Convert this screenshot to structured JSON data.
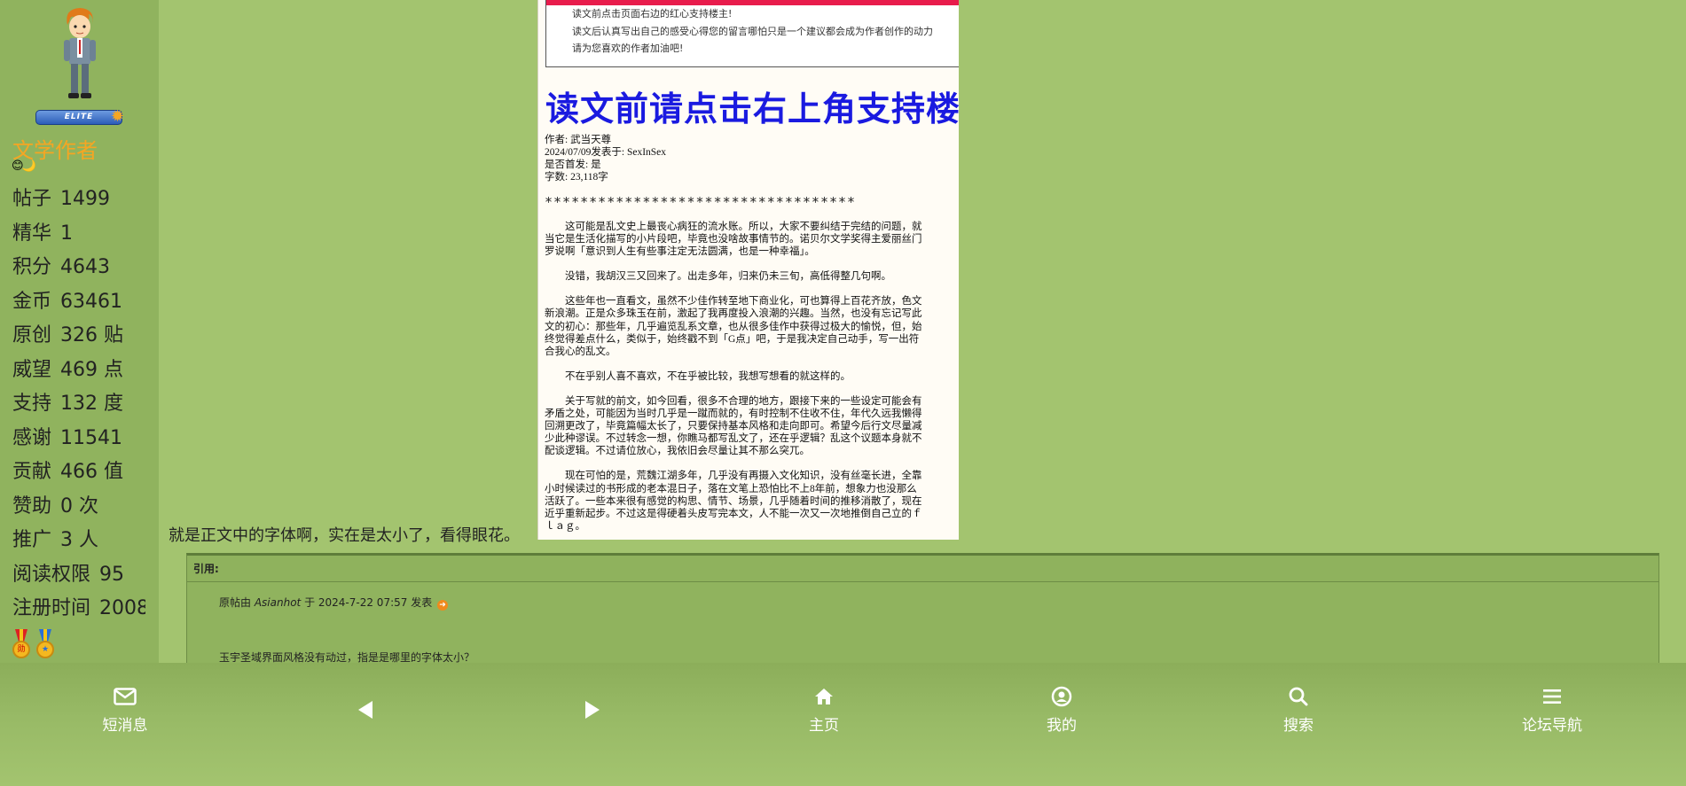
{
  "sidebar": {
    "rank_badge": "ELITE",
    "author_group": "文学作者",
    "emojis": "😊🌙",
    "stats": [
      {
        "label": "帖子",
        "value": "1499"
      },
      {
        "label": "精华",
        "value": "1"
      },
      {
        "label": "积分",
        "value": "4643"
      },
      {
        "label": "金币",
        "value": "63461"
      },
      {
        "label": "原创",
        "value": "326 贴"
      },
      {
        "label": "威望",
        "value": "469 点"
      },
      {
        "label": "支持",
        "value": "132 度"
      },
      {
        "label": "感谢",
        "value": "11541"
      },
      {
        "label": "贡献",
        "value": "466 值"
      },
      {
        "label": "赞助",
        "value": "0 次"
      },
      {
        "label": "推广",
        "value": "3 人"
      },
      {
        "label": "阅读权限",
        "value": "95"
      },
      {
        "label": "注册时间",
        "value": "2008"
      }
    ]
  },
  "screenshot": {
    "notice_lines": [
      "读文前点击页面右边的红心支持楼主!",
      "读文后认真写出自己的感受心得您的留言哪怕只是一个建议都会成为作者创作的动力",
      "请为您喜欢的作者加油吧!"
    ],
    "title": "读文前请点击右上角支持楼主",
    "meta_lines": [
      "作者: 武当天尊",
      "2024/07/09发表于: SexInSex",
      "是否首发: 是",
      "字数: 23,118字"
    ],
    "stars": "***********************************",
    "paragraphs": [
      "这可能是乱文史上最丧心病狂的流水账。所以，大家不要纠结于完结的问题，就当它是生活化描写的小片段吧，毕竟也没啥故事情节的。诺贝尔文学奖得主爱丽丝门罗说啊「意识到人生有些事注定无法圆满，也是一种幸福」。",
      "没错，我胡汉三又回来了。出走多年，归来仍未三旬，高低得整几句啊。",
      "这些年也一直看文，虽然不少佳作转至地下商业化，可也算得上百花齐放，色文新浪潮。正是众多珠玉在前，激起了我再度投入浪潮的兴趣。当然，也没有忘记写此文的初心：那些年，几乎遍览乱系文章，也从很多佳作中获得过极大的愉悦，但，始终觉得差点什么，类似于，始终戳不到「G点」吧，于是我决定自己动手，写一出符合我心的乱文。",
      "不在乎别人喜不喜欢，不在乎被比较，我想写想看的就这样的。",
      "关于写就的前文，如今回看，很多不合理的地方，跟接下来的一些设定可能会有矛盾之处，可能因为当时几乎是一蹴而就的，有时控制不住收不住，年代久远我懒得回溯更改了，毕竟篇幅太长了，只要保持基本风格和走向即可。希望今后行文尽量减少此种谬误。不过转念一想，你瞧马都写乱文了，还在乎逻辑？乱这个议题本身就不配谈逻辑。不过请位放心，我依旧会尽量让其不那么突兀。",
      "现在可怕的是，荒魏江湖多年，几乎没有再摄入文化知识，没有丝毫长进，全靠小时候读过的书形成的老本混日子，落在文笔上恐怕比不上8年前，想象力也没那么活跃了。一些本来很有感觉的构思、情节、场景，几乎随着时间的推移消散了，现在近乎重新起步。不过这是得硬着头皮写完本文，人不能一次又一次地推倒自己立的ｆｌａｇ。"
    ]
  },
  "post_text": "就是正文中的字体啊，实在是太小了，看得眼花。",
  "quote": {
    "header": "引用:",
    "meta_prefix": "原帖由",
    "meta_author": "Asianhot",
    "meta_suffix": "于 2024-7-22 07:57 发表",
    "body": "玉宇圣域界面风格没有动过，指是是哪里的字体太小？"
  },
  "bottom_nav": {
    "messages": "短消息",
    "home": "主页",
    "mine": "我的",
    "search": "搜索",
    "forum_nav": "论坛导航"
  },
  "colors": {
    "page_bg": "#a3c46f",
    "sidebar_bg": "#90b35e",
    "author_group": "#f5a623",
    "title_blue": "#1a1ae0",
    "notice_red": "#e81c4c"
  },
  "icons": [
    "avatar",
    "elite-star-icon",
    "medal-icon",
    "mail-icon",
    "back-arrow-icon",
    "forward-arrow-icon",
    "home-icon",
    "user-icon",
    "search-icon",
    "menu-icon",
    "jump-to-post-icon"
  ]
}
